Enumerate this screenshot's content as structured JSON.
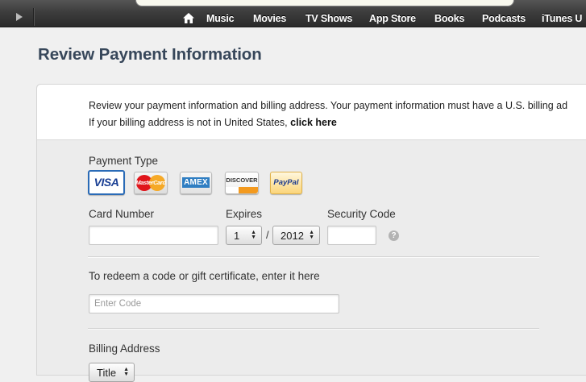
{
  "nav": {
    "items": [
      {
        "label": "Music"
      },
      {
        "label": "Movies"
      },
      {
        "label": "TV Shows"
      },
      {
        "label": "App Store"
      },
      {
        "label": "Books"
      },
      {
        "label": "Podcasts"
      },
      {
        "label": "iTunes U"
      }
    ]
  },
  "page": {
    "title": "Review Payment Information"
  },
  "intro": {
    "line1": "Review your payment information and billing address. Your payment information must have a U.S. billing ad",
    "line2_prefix": "If your billing address is not in United States, ",
    "line2_link": "click here"
  },
  "payment": {
    "type_label": "Payment Type",
    "cards": [
      {
        "label": "VISA",
        "selected": true
      },
      {
        "label": "MasterCard"
      },
      {
        "label": "AMEX"
      },
      {
        "label": "DISCOVER"
      },
      {
        "label": "PayPal"
      }
    ],
    "card_number_label": "Card Number",
    "card_number_value": "",
    "expires_label": "Expires",
    "month_value": "1",
    "slash": "/",
    "year_value": "2012",
    "security_label": "Security Code",
    "security_value": "",
    "help_glyph": "?"
  },
  "redeem": {
    "label": "To redeem a code or gift certificate, enter it here",
    "placeholder": "Enter Code"
  },
  "billing": {
    "label": "Billing Address",
    "title_select": "Title"
  },
  "colors": {
    "title": "#37475a",
    "visa_border": "#2a6bb7",
    "nav_bg": "#3d3d3d",
    "panel_bg": "#ececec"
  },
  "icons": [
    "play-icon",
    "home-icon",
    "help-icon",
    "select-arrows-icon"
  ]
}
